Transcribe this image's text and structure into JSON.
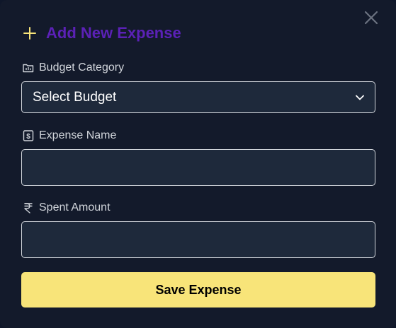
{
  "modal": {
    "title": "Add New Expense",
    "icons": {
      "title": "plus-icon",
      "close": "close-icon"
    },
    "colors": {
      "background": "#131a2b",
      "title": "#5b21b6",
      "accent_plus": "#f8e479",
      "input_bg": "#1e293b",
      "button_bg": "#f8e479"
    }
  },
  "form": {
    "budget_category": {
      "label": "Budget Category",
      "icon": "folder-icon",
      "selected": "Select Budget"
    },
    "expense_name": {
      "label": "Expense Name",
      "icon": "receipt-dollar-icon",
      "value": ""
    },
    "spent_amount": {
      "label": "Spent Amount",
      "icon": "rupee-icon",
      "value": ""
    },
    "submit_label": "Save Expense"
  }
}
